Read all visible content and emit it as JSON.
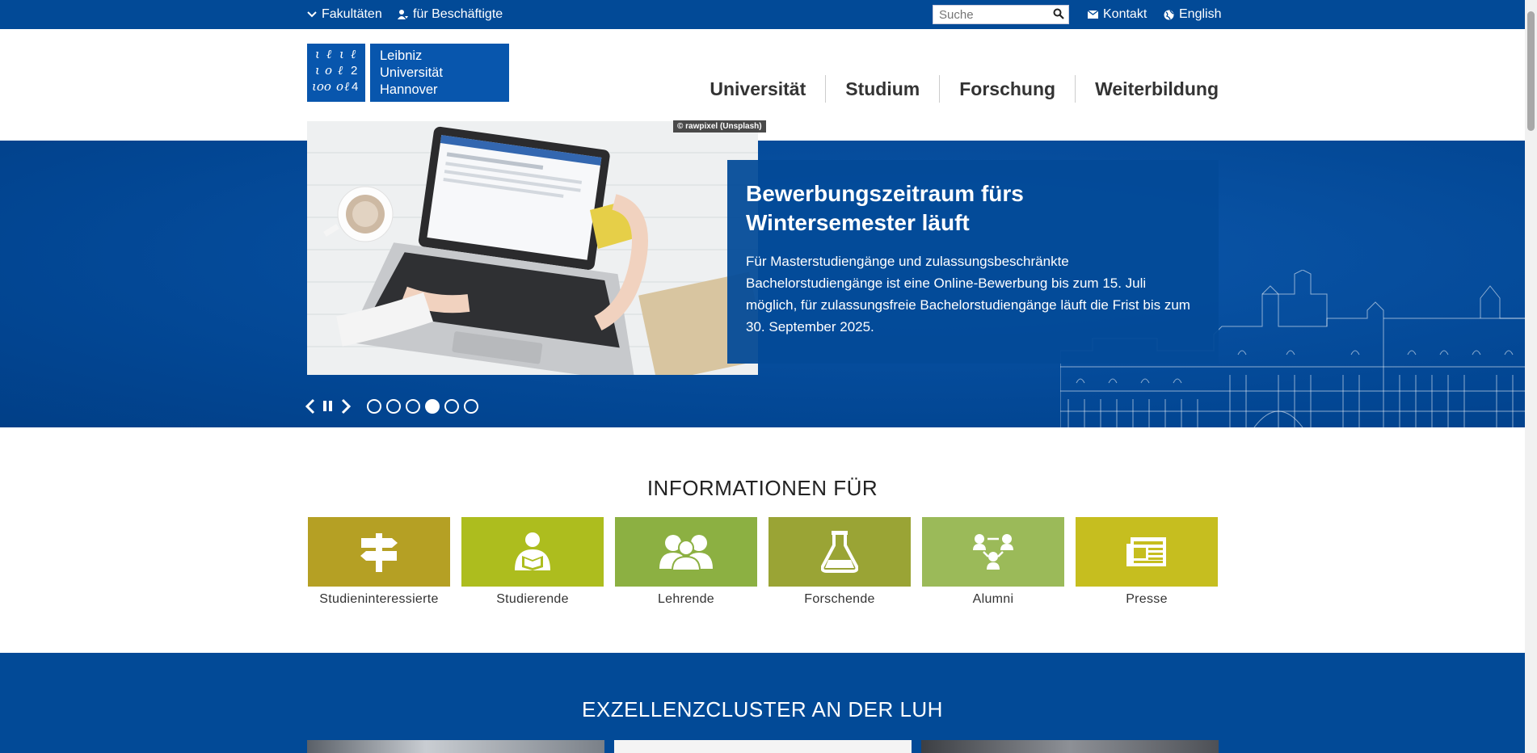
{
  "topbar": {
    "faculties_label": "Fakultäten",
    "staff_label": "für Beschäftigte",
    "search_placeholder": "Suche",
    "contact_label": "Kontakt",
    "language_label": "English"
  },
  "logo": {
    "line1": "Leibniz",
    "line2": "Universität",
    "line3": "Hannover"
  },
  "nav": [
    "Universität",
    "Studium",
    "Forschung",
    "Weiterbildung"
  ],
  "hero": {
    "credit": "© rawpixel (Unsplash)",
    "title": "Bewerbungszeitraum fürs Wintersemester läuft",
    "text": "Für Masterstudiengänge und zulassungsbeschränkte Bachelorstudiengänge ist eine Online-Bewerbung bis zum 15. Juli möglich, für zulassungsfreie Bachelorstudiengänge läuft die Frist bis zum 30. September 2025.",
    "slide_count": 6,
    "active_slide": 4
  },
  "info": {
    "title": "INFORMATIONEN FÜR",
    "tiles": [
      {
        "label": "Studieninteressierte",
        "color": "#b5a024",
        "icon": "signpost-icon"
      },
      {
        "label": "Studierende",
        "color": "#adbd1e",
        "icon": "student-icon"
      },
      {
        "label": "Lehrende",
        "color": "#8cb042",
        "icon": "group-icon"
      },
      {
        "label": "Forschende",
        "color": "#9aa435",
        "icon": "flask-icon"
      },
      {
        "label": "Alumni",
        "color": "#9bba59",
        "icon": "network-icon"
      },
      {
        "label": "Presse",
        "color": "#c6be1f",
        "icon": "newspaper-icon"
      }
    ]
  },
  "cluster": {
    "title": "EXZELLENZCLUSTER AN DER LUH"
  },
  "colors": {
    "brand_blue": "#024a97",
    "hero_blue": "#0856ad"
  }
}
